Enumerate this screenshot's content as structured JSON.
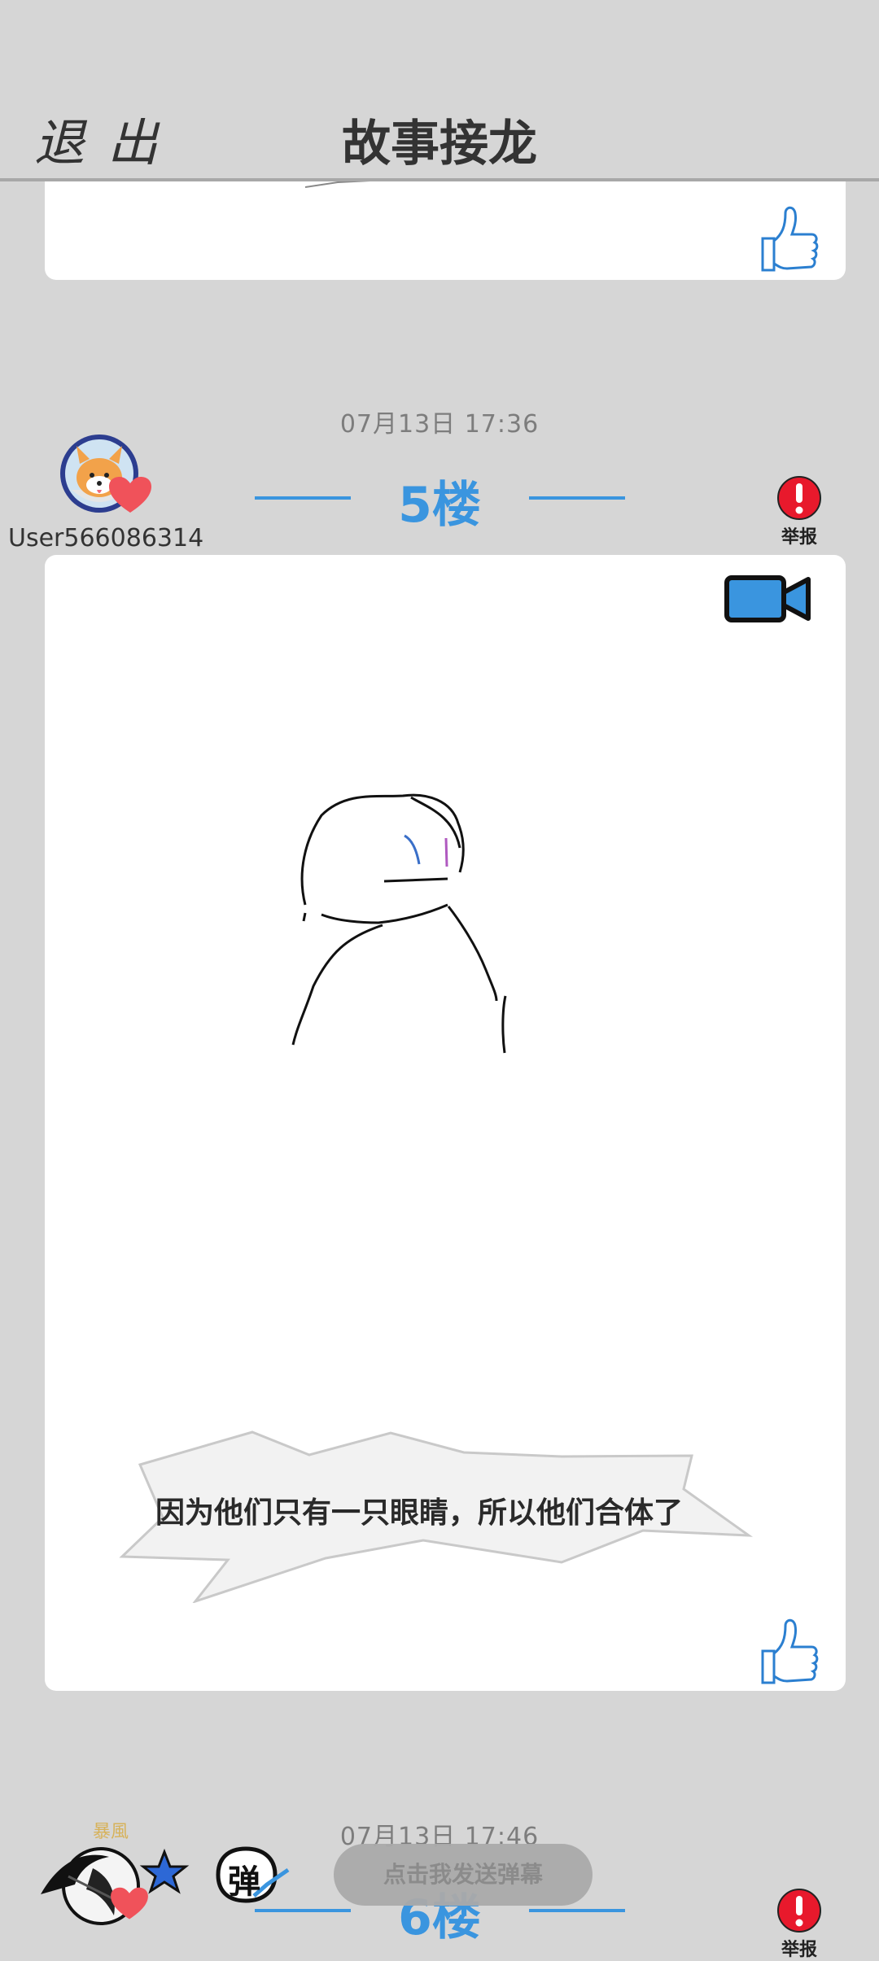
{
  "header": {
    "exit_label": "退出",
    "title": "故事接龙"
  },
  "posts": [
    {
      "timestamp": "07月13日  17:36",
      "floor": "5楼",
      "username": "User566086314",
      "report_label": "举报",
      "caption": "因为他们只有一只眼睛，所以他们合体了"
    },
    {
      "timestamp": "07月13日  17:46",
      "floor": "6楼",
      "report_label": "举报"
    }
  ],
  "bottom_bar": {
    "danmaku_toggle_glyph": "弹",
    "danmaku_placeholder": "点击我发送弹幕",
    "badge_text": "暴風"
  },
  "icons": {
    "like": "thumbs-up-icon",
    "video": "video-camera-icon",
    "report": "exclamation-icon",
    "heart": "heart-icon",
    "star": "star-icon"
  },
  "colors": {
    "accent": "#3a95df",
    "report_red": "#e8192c",
    "heart": "#f0525a",
    "background": "#d6d6d6"
  }
}
